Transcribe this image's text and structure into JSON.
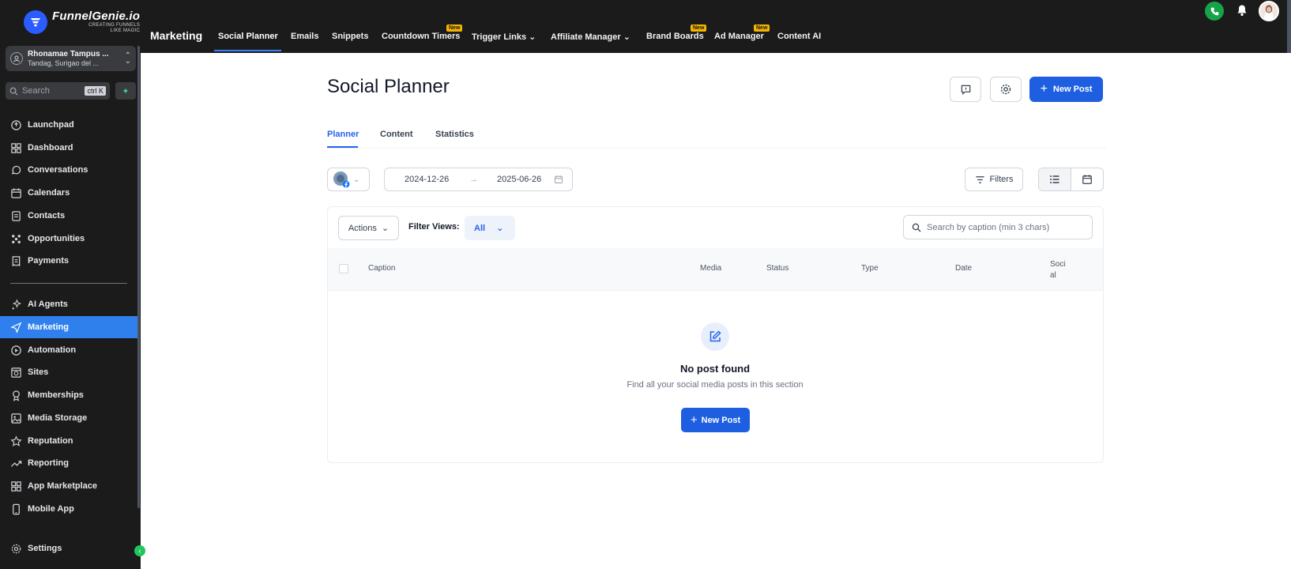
{
  "brand": {
    "name": "FunnelGenie.io",
    "tagline_line1": "CREATING FUNNELS",
    "tagline_line2": "LIKE MAGIC"
  },
  "account": {
    "name": "Rhonamae Tampus ...",
    "location": "Tandag, Surigao del ..."
  },
  "sidebar_search": {
    "placeholder": "Search",
    "shortcut": "ctrl K"
  },
  "sidebar": {
    "items": [
      {
        "label": "Launchpad",
        "icon": "rocket-icon"
      },
      {
        "label": "Dashboard",
        "icon": "grid-icon"
      },
      {
        "label": "Conversations",
        "icon": "chat-icon"
      },
      {
        "label": "Calendars",
        "icon": "calendar-icon"
      },
      {
        "label": "Contacts",
        "icon": "contact-card-icon"
      },
      {
        "label": "Opportunities",
        "icon": "pipeline-icon"
      },
      {
        "label": "Payments",
        "icon": "receipt-icon"
      },
      {
        "label": "AI Agents",
        "icon": "sparkle-icon"
      },
      {
        "label": "Marketing",
        "icon": "send-icon",
        "active": true
      },
      {
        "label": "Automation",
        "icon": "automation-icon"
      },
      {
        "label": "Sites",
        "icon": "globe-icon"
      },
      {
        "label": "Memberships",
        "icon": "membership-icon"
      },
      {
        "label": "Media Storage",
        "icon": "image-icon"
      },
      {
        "label": "Reputation",
        "icon": "star-icon"
      },
      {
        "label": "Reporting",
        "icon": "trend-icon"
      },
      {
        "label": "App Marketplace",
        "icon": "apps-icon"
      },
      {
        "label": "Mobile App",
        "icon": "phone-icon"
      }
    ],
    "settings_label": "Settings"
  },
  "topbar": {
    "section": "Marketing",
    "tabs": [
      {
        "label": "Social Planner",
        "active": true
      },
      {
        "label": "Emails"
      },
      {
        "label": "Snippets"
      },
      {
        "label": "Countdown Timers",
        "badge": "New"
      },
      {
        "label": "Trigger Links",
        "dropdown": true
      },
      {
        "label": "Affiliate Manager",
        "dropdown": true
      },
      {
        "label": "Brand Boards",
        "badge": "New"
      },
      {
        "label": "Ad Manager",
        "badge": "New"
      },
      {
        "label": "Content AI"
      }
    ]
  },
  "page": {
    "title": "Social Planner",
    "new_post_label": "New Post",
    "subtabs": [
      {
        "label": "Planner",
        "active": true
      },
      {
        "label": "Content"
      },
      {
        "label": "Statistics"
      }
    ],
    "date_start": "2024-12-26",
    "date_end": "2025-06-26",
    "filters_label": "Filters",
    "actions_label": "Actions",
    "filter_views_label": "Filter Views:",
    "filter_views_value": "All",
    "caption_search_placeholder": "Search by caption (min 3 chars)",
    "columns": [
      "Caption",
      "Media",
      "Status",
      "Type",
      "Date",
      "Soci al"
    ],
    "empty_title": "No post found",
    "empty_subtitle": "Find all your social media posts in this section",
    "empty_button": "New Post"
  },
  "colors": {
    "primary": "#1d5fe0",
    "sidebar_bg": "#1b1b1b",
    "active_nav": "#2f80ed",
    "badge": "#f5b400"
  }
}
